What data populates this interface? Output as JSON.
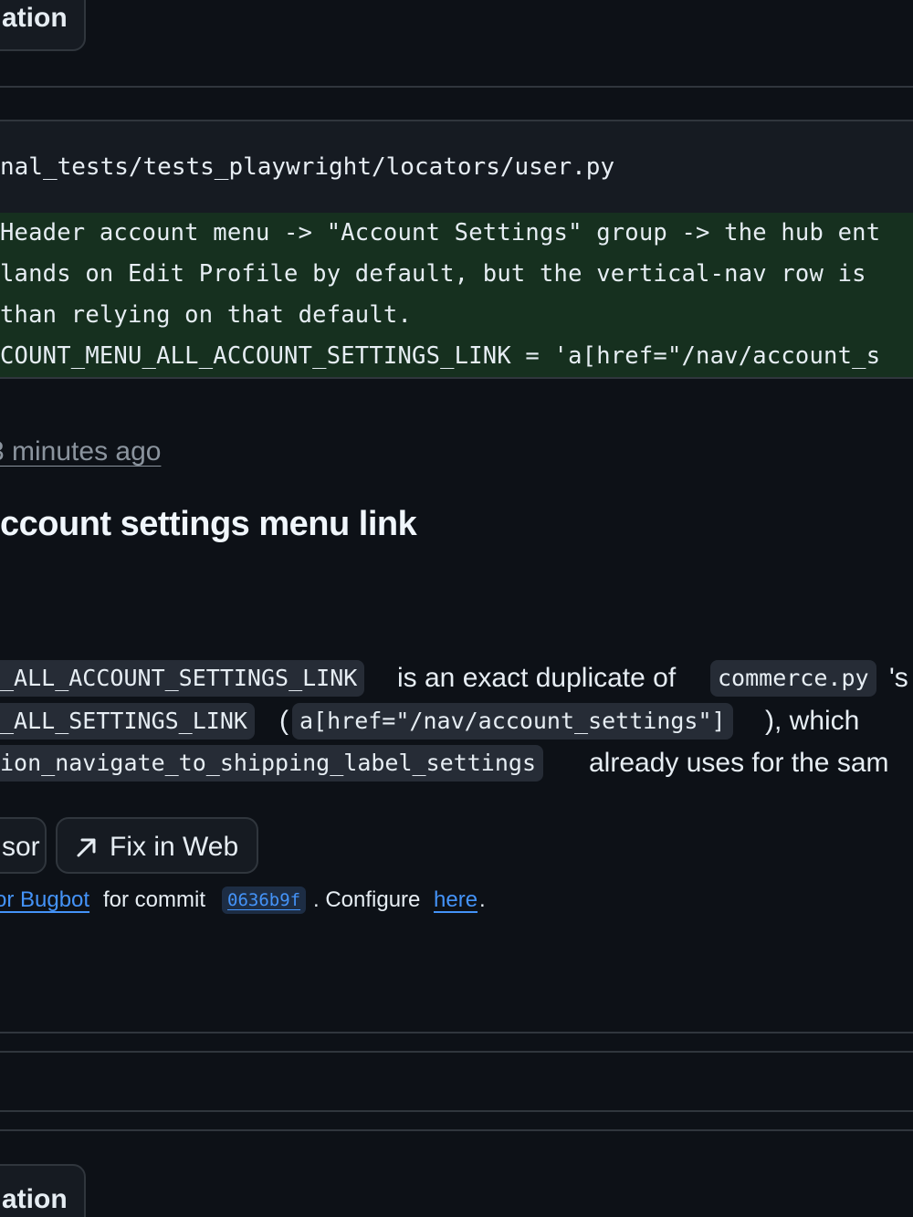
{
  "top_button": {
    "label": "ation"
  },
  "file": {
    "path": "nal_tests/tests_playwright/locators/user.py",
    "diff_lines": [
      "Header account menu -> \"Account Settings\" group -> the hub ent",
      "lands on Edit Profile by default, but the vertical-nav row is",
      "than relying on that default.",
      "COUNT_MENU_ALL_ACCOUNT_SETTINGS_LINK = 'a[href=\"/nav/account_s"
    ]
  },
  "comment": {
    "timestamp": "3 minutes ago",
    "title": "ccount settings menu link",
    "line1": {
      "code1": "_ALL_ACCOUNT_SETTINGS_LINK",
      "text1": "is an exact duplicate of",
      "code2": "commerce.py",
      "text2": "'s"
    },
    "line2": {
      "code1": "_ALL_SETTINGS_LINK",
      "text1": "(",
      "code2": "a[href=\"/nav/account_settings\"]",
      "text2": "), which"
    },
    "line3": {
      "code1": "ion_navigate_to_shipping_label_settings",
      "text1": "already uses for the sam"
    }
  },
  "actions": {
    "cursor_label": "sor",
    "fix_web_label": "Fix in Web",
    "fix_web_icon": "arrow-up-right-icon"
  },
  "footer": {
    "link1": "or Bugbot",
    "text1": "for commit",
    "sha": "0636b9f",
    "text2": ". Configure",
    "link2": "here",
    "text3": "."
  },
  "bottom_button": {
    "label": "ation"
  }
}
